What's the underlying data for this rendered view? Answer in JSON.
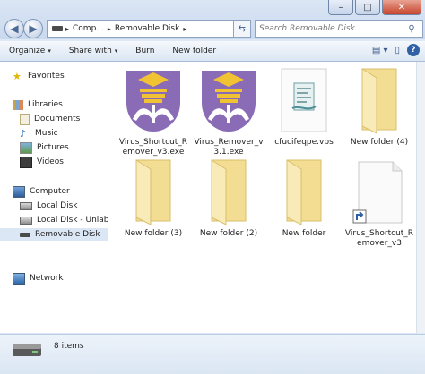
{
  "window": {
    "caption_buttons": {
      "minimize": "–",
      "maximize": "□",
      "close": "✕"
    }
  },
  "address": {
    "segments": [
      "Comp...",
      "Removable Disk"
    ],
    "separator": "▸"
  },
  "search": {
    "placeholder": "Search Removable Disk"
  },
  "toolbar": {
    "organize": "Organize",
    "share_with": "Share with",
    "burn": "Burn",
    "new_folder": "New folder"
  },
  "nav": {
    "favorites": "Favorites",
    "libraries": "Libraries",
    "documents": "Documents",
    "music": "Music",
    "pictures": "Pictures",
    "videos": "Videos",
    "computer": "Computer",
    "local_disk": "Local Disk",
    "local_disk_unlabeled": "Local Disk - Unlabeled",
    "removable_disk": "Removable Disk",
    "network": "Network"
  },
  "files": [
    {
      "name": "Virus_Shortcut_Remover_v3.exe",
      "icon": "uitm-logo-icon"
    },
    {
      "name": "Virus_Remover_v3.1.exe",
      "icon": "uitm-logo-icon"
    },
    {
      "name": "cfucifeqpe.vbs",
      "icon": "vbs-script-icon"
    },
    {
      "name": "New folder (4)",
      "icon": "folder-icon"
    },
    {
      "name": "New folder (3)",
      "icon": "folder-icon"
    },
    {
      "name": "New folder (2)",
      "icon": "folder-icon"
    },
    {
      "name": "New folder",
      "icon": "folder-icon"
    },
    {
      "name": "Virus_Shortcut_Remover_v3",
      "icon": "shortcut-file-icon"
    }
  ],
  "labels_wrapped": {
    "f0": [
      "Virus_Shortcut_R",
      "emover_v3.exe"
    ],
    "f1": [
      "Virus_Remover_v",
      "3.1.exe"
    ],
    "f7": [
      "Virus_Shortcut_R",
      "emover_v3"
    ]
  },
  "status": {
    "count": "8 items"
  },
  "colors": {
    "accent": "#2f5fa5",
    "logo_purple": "#8a6bb5",
    "logo_gold": "#f1c232",
    "folder": "#f6e6a8"
  }
}
